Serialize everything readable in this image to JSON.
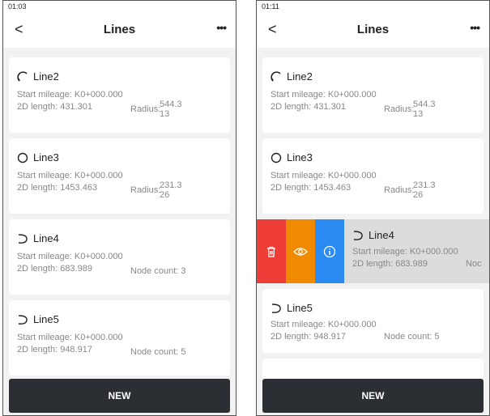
{
  "left": {
    "time": "01:03",
    "title": "Lines",
    "more": "•••",
    "back": "<",
    "cards": [
      {
        "name": "Line2",
        "mileage": "Start mileage: K0+000.000",
        "length": "2D length: 431.301",
        "extra_label": "Radius:",
        "extra_value": "544.313",
        "icon": "arc-icon"
      },
      {
        "name": "Line3",
        "mileage": "Start mileage: K0+000.000",
        "length": "2D length: 1453.463",
        "extra_label": "Radius:",
        "extra_value": "231.326",
        "icon": "circle-icon"
      },
      {
        "name": "Line4",
        "mileage": "Start mileage: K0+000.000",
        "length": "2D length: 683.989",
        "extra_label": "Node count: 3",
        "icon": "curve-icon"
      },
      {
        "name": "Line5",
        "mileage": "Start mileage: K0+000.000",
        "length": "2D length: 948.917",
        "extra_label": "Node count: 5",
        "icon": "curve-icon"
      }
    ],
    "new_label": "NEW"
  },
  "right": {
    "time": "01:11",
    "title": "Lines",
    "more": "•••",
    "back": "<",
    "cards": [
      {
        "name": "Line2",
        "mileage": "Start mileage: K0+000.000",
        "length": "2D length: 431.301",
        "extra_label": "Radius:",
        "extra_value": "544.313",
        "icon": "arc-icon"
      },
      {
        "name": "Line3",
        "mileage": "Start mileage: K0+000.000",
        "length": "2D length: 1453.463",
        "extra_label": "Radius:",
        "extra_value": "231.326",
        "icon": "circle-icon"
      },
      {
        "name": "Line4",
        "mileage": "Start mileage: K0+000.000",
        "length": "2D length: 683.989",
        "extra_label": "Noc",
        "icon": "curve-icon"
      },
      {
        "name": "Line5",
        "mileage": "Start mileage: K0+000.000",
        "length": "2D length: 948.917",
        "extra_label": "Node count: 5",
        "icon": "curve-icon"
      }
    ],
    "swipe_actions": [
      {
        "icon": "trash-icon",
        "color": "#ee3d37"
      },
      {
        "icon": "eye-icon",
        "color": "#f08a00"
      },
      {
        "icon": "info-icon",
        "color": "#2b8bf3"
      }
    ],
    "new_label": "NEW"
  }
}
